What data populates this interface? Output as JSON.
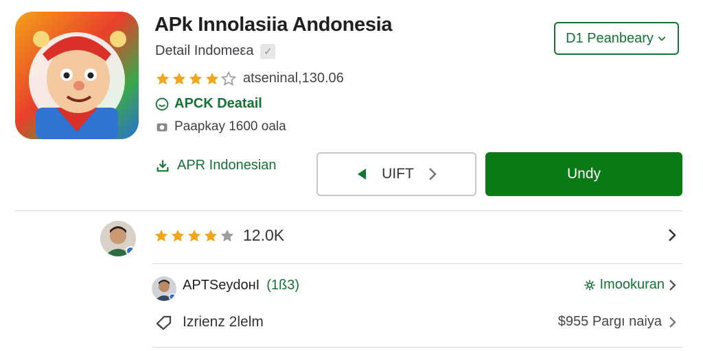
{
  "app": {
    "title": "APk Innolasiia Andonesia",
    "subtitle": "Detail Indomeεa",
    "rating_text": "atseninal,130.06",
    "rating_stars": 4,
    "detail_link": "APCK Deatail",
    "package_text": "Paapkay 1600 oala",
    "download_label": "APR Indonesian"
  },
  "header_button": {
    "label": "D1 Peanbeary"
  },
  "nav_button": {
    "label": "UIFT"
  },
  "primary_button": {
    "label": "Undy"
  },
  "reviews": {
    "stars": 4,
    "count": "12.0K"
  },
  "developer": {
    "name": "APTSeydoнI",
    "count": "(1ß3)",
    "link": "Imookuran"
  },
  "size_row": {
    "label": "Izrienz 2lelm",
    "price": "$955 Pargı naiya"
  },
  "colors": {
    "accent": "#137333",
    "primary_button": "#0a7a16",
    "star": "#f4a51c",
    "divider": "#d9d9d9"
  },
  "icons": {
    "verified": "check-icon",
    "detail": "smile-circle-icon",
    "package": "camera-icon",
    "download": "download-icon",
    "dropdown": "chevron-down-icon",
    "nav_prev": "triangle-left-icon",
    "nav_next": "chevron-right-icon",
    "row_more": "chevron-right-icon",
    "developer_link": "gear-icon",
    "size": "tag-icon"
  }
}
